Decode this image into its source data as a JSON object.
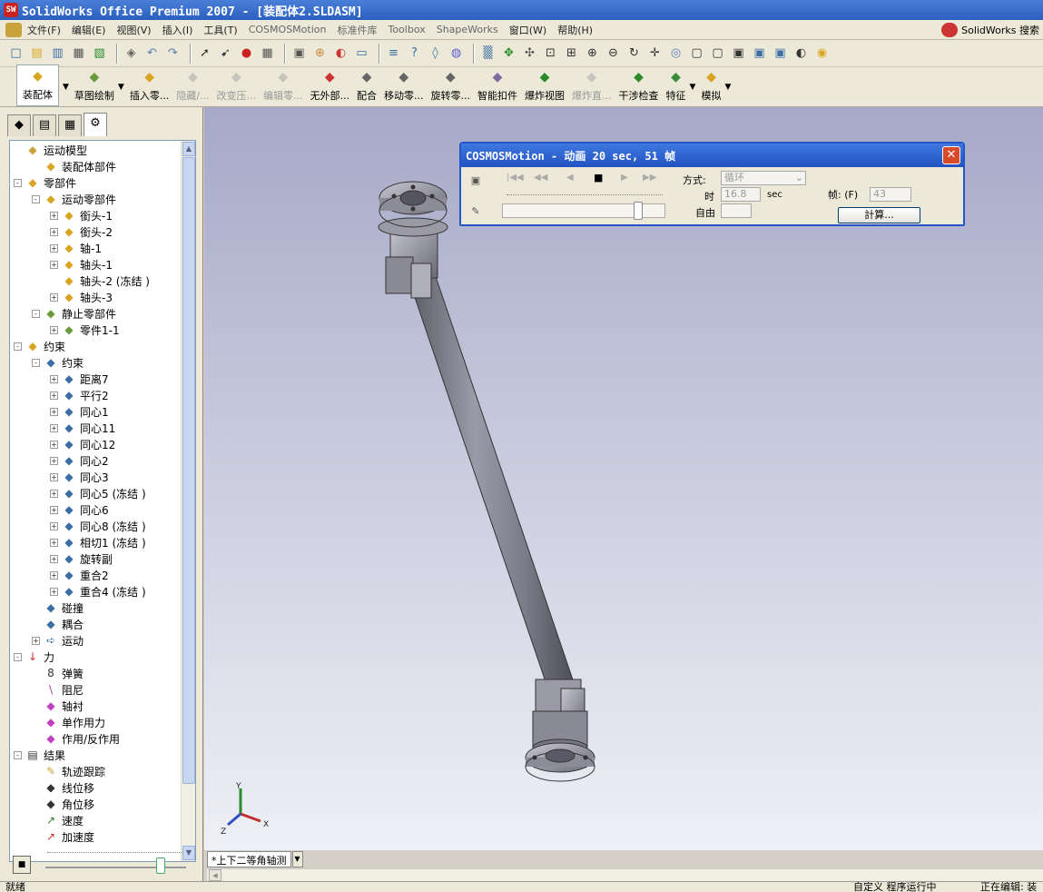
{
  "window": {
    "title": "SolidWorks Office Premium 2007 - [装配体2.SLDASM]",
    "app_icon": "SW"
  },
  "menubar": {
    "items": [
      "文件(F)",
      "编辑(E)",
      "视图(V)",
      "插入(I)",
      "工具(T)",
      "COSMOSMotion",
      "标准件库",
      "Toolbox",
      "ShapeWorks",
      "窗口(W)",
      "帮助(H)"
    ],
    "search_label": "SolidWorks 搜索"
  },
  "toolbar1": {
    "icons": [
      "new-icon",
      "open-icon",
      "save-icon",
      "print-icon",
      "rebuild-icon",
      "options-icon",
      "undo-icon",
      "redo-icon",
      "select-icon",
      "select-other-icon",
      "traffic-light-icon",
      "grid-icon",
      "view-settings-icon",
      "zoom-icon",
      "display-icon",
      "window-icon",
      "list-icon",
      "help-icon",
      "draft-icon",
      "appearance-icon",
      "section-icon",
      "move-icon",
      "pan-icon",
      "zoom-fit-icon",
      "zoom-area-icon",
      "zoom-in-icon",
      "zoom-out-icon",
      "rotate-icon",
      "translate-icon",
      "view-orientation-icon",
      "front-view-icon",
      "wireframe-icon",
      "hidden-lines-icon",
      "shaded-icon",
      "shaded-edges-icon",
      "shadow-icon",
      "realview-icon"
    ]
  },
  "commandmanager": {
    "items": [
      {
        "label": "装配体",
        "icon": "assembly-icon",
        "state": "pressed"
      },
      {
        "label": "草图绘制",
        "icon": "sketch-icon",
        "state": "normal"
      },
      {
        "label": "插入零...",
        "icon": "insert-part-icon",
        "state": "normal"
      },
      {
        "label": "隐藏/...",
        "icon": "hide-icon",
        "state": "disabled"
      },
      {
        "label": "改变压...",
        "icon": "change-icon",
        "state": "disabled"
      },
      {
        "label": "编辑零...",
        "icon": "edit-part-icon",
        "state": "disabled"
      },
      {
        "label": "无外部...",
        "icon": "no-external-icon",
        "state": "normal"
      },
      {
        "label": "配合",
        "icon": "mate-icon",
        "state": "normal"
      },
      {
        "label": "移动零...",
        "icon": "move-part-icon",
        "state": "normal"
      },
      {
        "label": "旋转零...",
        "icon": "rotate-part-icon",
        "state": "normal"
      },
      {
        "label": "智能扣件",
        "icon": "fastener-icon",
        "state": "normal"
      },
      {
        "label": "爆炸视图",
        "icon": "explode-icon",
        "state": "normal"
      },
      {
        "label": "爆炸直...",
        "icon": "explode-line-icon",
        "state": "disabled"
      },
      {
        "label": "干涉检查",
        "icon": "interference-icon",
        "state": "normal"
      },
      {
        "label": "特征",
        "icon": "feature-icon",
        "state": "normal"
      },
      {
        "label": "模拟",
        "icon": "simulation-icon",
        "state": "normal"
      }
    ]
  },
  "left_panel": {
    "tabs": [
      "feature-manager-tab",
      "property-manager-tab",
      "config-manager-tab",
      "motion-manager-tab"
    ],
    "tree": [
      {
        "label": "运动模型",
        "level": 0,
        "exp": "",
        "icon": "motion-model-icon"
      },
      {
        "label": "装配体部件",
        "level": 1,
        "exp": "",
        "icon": "assembly-part-icon"
      },
      {
        "label": "零部件",
        "level": 0,
        "exp": "-",
        "icon": "parts-icon"
      },
      {
        "label": "运动零部件",
        "level": 1,
        "exp": "-",
        "icon": "moving-parts-icon"
      },
      {
        "label": "銜头-1",
        "level": 2,
        "exp": "+",
        "icon": "part-icon"
      },
      {
        "label": "銜头-2",
        "level": 2,
        "exp": "+",
        "icon": "part-icon"
      },
      {
        "label": "轴-1",
        "level": 2,
        "exp": "+",
        "icon": "part-icon"
      },
      {
        "label": "轴头-1",
        "level": 2,
        "exp": "+",
        "icon": "part-icon"
      },
      {
        "label": "轴头-2 (冻结 )",
        "level": 2,
        "exp": "",
        "icon": "part-icon"
      },
      {
        "label": "轴头-3",
        "level": 2,
        "exp": "+",
        "icon": "part-icon"
      },
      {
        "label": "静止零部件",
        "level": 1,
        "exp": "-",
        "icon": "ground-parts-icon"
      },
      {
        "label": "零件1-1",
        "level": 2,
        "exp": "+",
        "icon": "ground-part-icon"
      },
      {
        "label": "约束",
        "level": 0,
        "exp": "-",
        "icon": "constraints-icon"
      },
      {
        "label": "约束",
        "level": 1,
        "exp": "-",
        "icon": "constraint-icon"
      },
      {
        "label": "距离7",
        "level": 2,
        "exp": "+",
        "icon": "distance-icon"
      },
      {
        "label": "平行2",
        "level": 2,
        "exp": "+",
        "icon": "parallel-icon"
      },
      {
        "label": "同心1",
        "level": 2,
        "exp": "+",
        "icon": "concentric-icon"
      },
      {
        "label": "同心11",
        "level": 2,
        "exp": "+",
        "icon": "concentric-icon"
      },
      {
        "label": "同心12",
        "level": 2,
        "exp": "+",
        "icon": "concentric-icon"
      },
      {
        "label": "同心2",
        "level": 2,
        "exp": "+",
        "icon": "concentric-icon"
      },
      {
        "label": "同心3",
        "level": 2,
        "exp": "+",
        "icon": "concentric-icon"
      },
      {
        "label": "同心5 (冻结 )",
        "level": 2,
        "exp": "+",
        "icon": "concentric-icon"
      },
      {
        "label": "同心6",
        "level": 2,
        "exp": "+",
        "icon": "concentric-icon"
      },
      {
        "label": "同心8 (冻结 )",
        "level": 2,
        "exp": "+",
        "icon": "concentric-icon"
      },
      {
        "label": "相切1 (冻结 )",
        "level": 2,
        "exp": "+",
        "icon": "tangent-icon"
      },
      {
        "label": "旋转副",
        "level": 2,
        "exp": "+",
        "icon": "revolute-icon"
      },
      {
        "label": "重合2",
        "level": 2,
        "exp": "+",
        "icon": "coincident-icon"
      },
      {
        "label": "重合4 (冻结 )",
        "level": 2,
        "exp": "+",
        "icon": "coincident-icon"
      },
      {
        "label": "碰撞",
        "level": 1,
        "exp": "",
        "icon": "contact-icon"
      },
      {
        "label": "耦合",
        "level": 1,
        "exp": "",
        "icon": "coupler-icon"
      },
      {
        "label": "运动",
        "level": 1,
        "exp": "+",
        "icon": "motion-icon"
      },
      {
        "label": "力",
        "level": 0,
        "exp": "-",
        "icon": "force-icon"
      },
      {
        "label": "弹簧",
        "level": 1,
        "exp": "",
        "icon": "spring-icon"
      },
      {
        "label": "阻尼",
        "level": 1,
        "exp": "",
        "icon": "damper-icon"
      },
      {
        "label": "轴衬",
        "level": 1,
        "exp": "",
        "icon": "bushing-icon"
      },
      {
        "label": "单作用力",
        "level": 1,
        "exp": "",
        "icon": "action-force-icon"
      },
      {
        "label": "作用/反作用",
        "level": 1,
        "exp": "",
        "icon": "action-reaction-icon"
      },
      {
        "label": "结果",
        "level": 0,
        "exp": "-",
        "icon": "results-icon"
      },
      {
        "label": "轨迹跟踪",
        "level": 1,
        "exp": "",
        "icon": "trace-icon"
      },
      {
        "label": "线位移",
        "level": 1,
        "exp": "",
        "icon": "linear-disp-icon"
      },
      {
        "label": "角位移",
        "level": 1,
        "exp": "",
        "icon": "angular-disp-icon"
      },
      {
        "label": "速度",
        "level": 1,
        "exp": "",
        "icon": "velocity-icon"
      },
      {
        "label": "加速度",
        "level": 1,
        "exp": "",
        "icon": "acceleration-icon"
      }
    ]
  },
  "dialog": {
    "title": "COSMOSMotion - 动画 20 sec, 51 帧",
    "mode_label": "方式:",
    "mode_value": "循环",
    "time_label": "时",
    "time_value": "16.8",
    "time_unit": "sec",
    "frame_label": "帧: (F)",
    "frame_value": "43",
    "free_label": "自由",
    "calc_button": "計算..."
  },
  "view_tab": {
    "label": "*上下二等角轴测"
  },
  "status": {
    "left": "就绪",
    "mid": "自定义  程序运行中",
    "right": "正在编辑: 装"
  },
  "triad": {
    "x": "X",
    "y": "Y",
    "z": "Z"
  },
  "colors": {
    "titlebar": "#2a5fc0",
    "viewport_top": "#a6a9c7",
    "viewport_bottom": "#eef0f5",
    "part": "#8f8f9c"
  }
}
